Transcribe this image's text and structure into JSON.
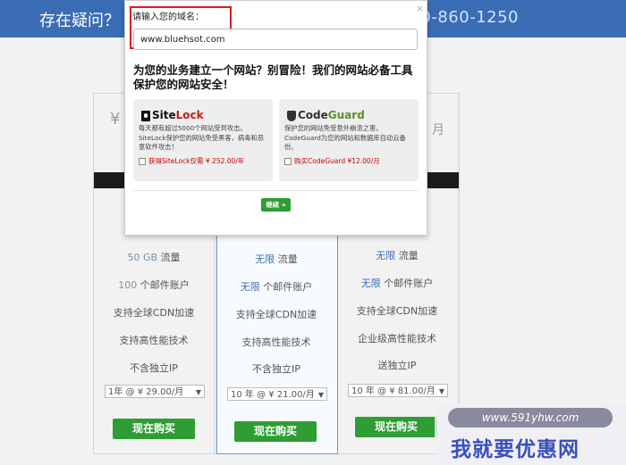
{
  "header": {
    "question": "存在疑问？",
    "phone": "400-860-1250"
  },
  "pricing": {
    "currency_symbol": "¥",
    "right_mark": "月",
    "columns": [
      {
        "traffic_value": "50 GB",
        "traffic_label": "流量",
        "mail_value": "100",
        "mail_label": "个邮件账户",
        "cdn": "支持全球CDN加速",
        "tech": "支持高性能技术",
        "ip": "不含独立IP",
        "select": "1年 @ ¥ 29.00/月",
        "buy": "现在购买"
      },
      {
        "traffic_value": "无限",
        "traffic_label": "流量",
        "mail_value": "无限",
        "mail_label": "个邮件账户",
        "cdn": "支持全球CDN加速",
        "tech": "支持高性能技术",
        "ip": "不含独立IP",
        "select": "10 年 @ ¥ 21.00/月",
        "buy": "现在购买"
      },
      {
        "traffic_value": "无限",
        "traffic_label": "流量",
        "mail_value": "无限",
        "mail_label": "个邮件账户",
        "cdn": "支持全球CDN加速",
        "tech": "企业级高性能技术",
        "ip": "送独立IP",
        "select": "10 年 @ ¥ 81.00/月",
        "buy": "现在购买"
      }
    ]
  },
  "modal": {
    "close": "×",
    "domain_label": "请输入您的域名：",
    "domain_value": "www.bluehsot.com",
    "headline": "为您的业务建立一个网站？别冒险！我们的网站必备工具保护您的网站安全！",
    "sitelock": {
      "logo_site": "Site",
      "logo_lock": "Lock",
      "desc": "每天都有超过5000个网站受到攻击。SiteLock保护您的网站免受黑客，病毒和恶意软件攻击！",
      "option": "获得SiteLock仅需 ¥ 252.00/年"
    },
    "codeguard": {
      "logo_code": "Code",
      "logo_guard": "Guard",
      "desc": "保护您的网站免受意外崩溃之害。CodeGuard为您的网站和数据库自动云备份。",
      "option": "购买CodeGuard ¥12.00/月"
    },
    "continue_label": "继续 »"
  },
  "watermark": {
    "url": "www.591yhw.com",
    "brand": "我就要优惠网"
  },
  "colors": {
    "header_bg": "#3a6db3",
    "buy_green": "#2e9d34",
    "highlight_red": "#e0191b"
  }
}
